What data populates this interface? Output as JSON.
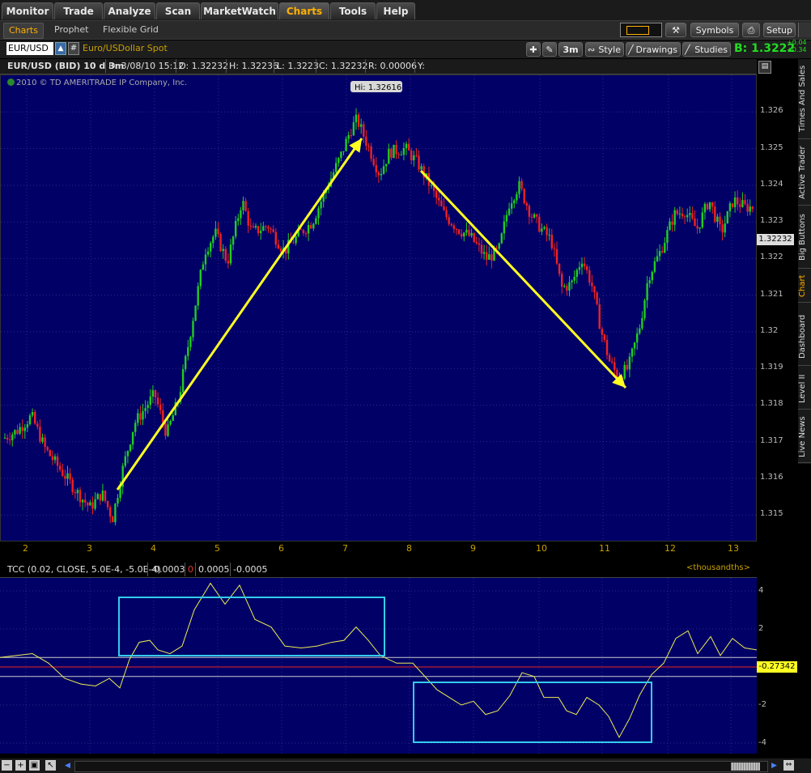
{
  "menu": {
    "tabs": [
      {
        "label": "Monitor"
      },
      {
        "label": "Trade"
      },
      {
        "label": "Analyze"
      },
      {
        "label": "Scan"
      },
      {
        "label": "MarketWatch"
      },
      {
        "label": "Charts"
      },
      {
        "label": "Tools"
      },
      {
        "label": "Help"
      }
    ],
    "active": "Charts"
  },
  "subtabs": {
    "items": [
      {
        "label": "Charts"
      },
      {
        "label": "Prophet"
      },
      {
        "label": "Flexible Grid"
      }
    ],
    "symbols_label": "Symbols",
    "setup_label": "Setup",
    "corner_values": [
      "+0.04",
      "+0.34"
    ]
  },
  "toolbar": {
    "symbol": "EUR/USD",
    "symbol_desc": "Euro/USDollar Spot",
    "link_symbol": "#",
    "timeframe": "3m",
    "style_label": "Style",
    "drawings_label": "Drawings",
    "studies_label": "Studies",
    "bid_label": "B: 1.3222"
  },
  "info": {
    "title": "EUR/USD (BID) 10 d 3m",
    "date": "D: 3/08/10 15:12",
    "open": "O: 1.32232",
    "high": "H: 1.32236",
    "low": "L: 1.3223",
    "close": "C: 1.32232",
    "range": "R: 0.00006",
    "y": "Y:"
  },
  "chart": {
    "copyright": "2010 © TD AMERITRADE IP Company, Inc.",
    "hi_label": "Hi: 1.32616",
    "last_price": "1.32232",
    "price_ticks": [
      "1.326",
      "1.325",
      "1.324",
      "1.323",
      "1.322",
      "1.321",
      "1.32",
      "1.319",
      "1.318",
      "1.317",
      "1.316",
      "1.315"
    ],
    "date_ticks": [
      "2",
      "3",
      "4",
      "5",
      "6",
      "7",
      "8",
      "9",
      "10",
      "11",
      "12",
      "13"
    ]
  },
  "study": {
    "name": "TCC (0.02, CLOSE, 5.0E-4, -5.0E-4)",
    "value1": "-0.0003",
    "value2": "0",
    "value3": "0.0005",
    "value4": "-0.0005",
    "units": "<thousandths>",
    "last_value": "-0.27342",
    "ticks": [
      "4",
      "2",
      "-2",
      "-4"
    ]
  },
  "sidebar": {
    "tabs": [
      {
        "label": "Times And Sales"
      },
      {
        "label": "Active Trader"
      },
      {
        "label": "Big Buttons"
      },
      {
        "label": "Chart"
      },
      {
        "label": "Dashboard"
      },
      {
        "label": "Level II"
      },
      {
        "label": "Live News"
      }
    ],
    "active": "Chart"
  },
  "colors": {
    "chart_bg": "#000066",
    "up_candle": "#22cc22",
    "down_candle": "#ee2222",
    "arrow": "#ffff22",
    "box": "#33ccee",
    "accent": "#ffb000",
    "bid": "#22dd22"
  }
}
